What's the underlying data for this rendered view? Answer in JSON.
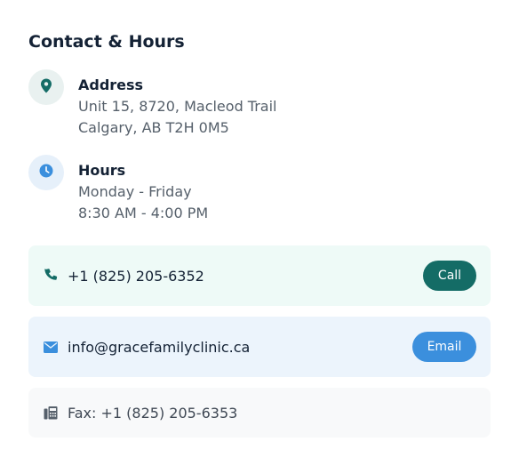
{
  "section": {
    "title": "Contact & Hours"
  },
  "address": {
    "label": "Address",
    "line1": "Unit 15, 8720, Macleod Trail",
    "line2": "Calgary, AB T2H 0M5",
    "icon": "location-pin-icon"
  },
  "hours": {
    "label": "Hours",
    "days": "Monday - Friday",
    "time": "8:30 AM - 4:00 PM",
    "icon": "clock-icon"
  },
  "phone": {
    "number": "+1 (825) 205-6352",
    "button_label": "Call",
    "icon": "phone-icon"
  },
  "email": {
    "address": "info@gracefamilyclinic.ca",
    "button_label": "Email",
    "icon": "envelope-icon"
  },
  "fax": {
    "text": "Fax: +1 (825) 205-6353",
    "icon": "fax-icon"
  },
  "colors": {
    "teal": "#146c66",
    "blue": "#3b8fdd",
    "heading": "#142235",
    "muted": "#56606b"
  }
}
